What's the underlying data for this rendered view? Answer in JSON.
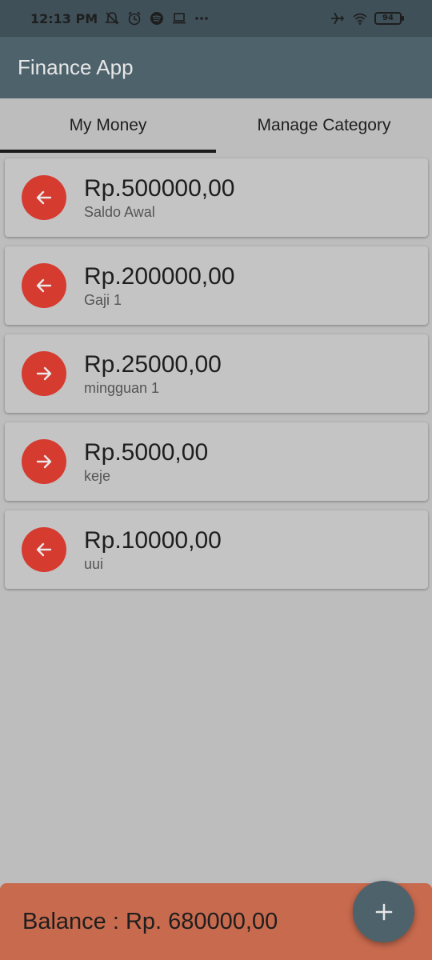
{
  "status_bar": {
    "time": "12:13 PM",
    "battery": "94",
    "icons": [
      "notifications-off-icon",
      "alarm-icon",
      "spotify-icon",
      "laptop-icon",
      "more-icon",
      "airplane-icon",
      "wifi-icon",
      "battery-icon"
    ]
  },
  "app_bar": {
    "title": "Finance App"
  },
  "tabs": [
    {
      "label": "My Money",
      "active": true
    },
    {
      "label": "Manage Category",
      "active": false
    }
  ],
  "transactions": [
    {
      "amount": "Rp.500000,00",
      "description": "Saldo Awal",
      "direction": "in",
      "icon": "arrow-left-icon"
    },
    {
      "amount": "Rp.200000,00",
      "description": "Gaji 1",
      "direction": "in",
      "icon": "arrow-left-icon"
    },
    {
      "amount": "Rp.25000,00",
      "description": "mingguan 1",
      "direction": "out",
      "icon": "arrow-right-icon"
    },
    {
      "amount": "Rp.5000,00",
      "description": "keje",
      "direction": "out",
      "icon": "arrow-right-icon"
    },
    {
      "amount": "Rp.10000,00",
      "description": "uui",
      "direction": "in",
      "icon": "arrow-left-icon"
    }
  ],
  "balance": {
    "text": "Balance : Rp. 680000,00"
  },
  "fab": {
    "icon": "plus-icon"
  },
  "colors": {
    "status_bar": "#3f5058",
    "app_bar": "#4e626c",
    "background": "#bdbdbd",
    "card": "#c4c4c4",
    "icon_circle": "#d63b30",
    "balance_bar": "#c86a4e",
    "fab": "#4e626c"
  }
}
